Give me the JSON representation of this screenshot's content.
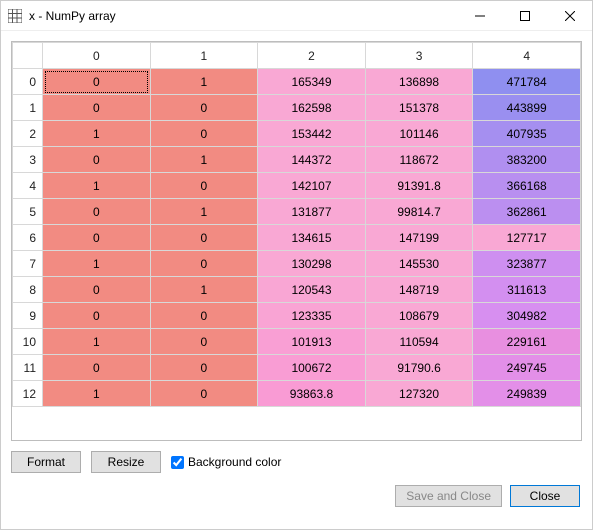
{
  "window": {
    "title": "x - NumPy array"
  },
  "buttons": {
    "format": "Format",
    "resize": "Resize",
    "bgcolor": "Background color",
    "save_close": "Save and Close",
    "close": "Close"
  },
  "checkbox": {
    "bgcolor_checked": true
  },
  "table": {
    "columns": [
      "0",
      "1",
      "2",
      "3",
      "4"
    ],
    "row_headers": [
      "0",
      "1",
      "2",
      "3",
      "4",
      "5",
      "6",
      "7",
      "8",
      "9",
      "10",
      "11",
      "12"
    ],
    "selected_cell": [
      0,
      0
    ]
  },
  "chart_data": {
    "type": "table",
    "title": "x - NumPy array",
    "columns": [
      "0",
      "1",
      "2",
      "3",
      "4"
    ],
    "rows": [
      [
        "0",
        "1",
        "165349",
        "136898",
        "471784"
      ],
      [
        "0",
        "0",
        "162598",
        "151378",
        "443899"
      ],
      [
        "1",
        "0",
        "153442",
        "101146",
        "407935"
      ],
      [
        "0",
        "1",
        "144372",
        "118672",
        "383200"
      ],
      [
        "1",
        "0",
        "142107",
        "91391.8",
        "366168"
      ],
      [
        "0",
        "1",
        "131877",
        "99814.7",
        "362861"
      ],
      [
        "0",
        "0",
        "134615",
        "147199",
        "127717"
      ],
      [
        "1",
        "0",
        "130298",
        "145530",
        "323877"
      ],
      [
        "0",
        "1",
        "120543",
        "148719",
        "311613"
      ],
      [
        "0",
        "0",
        "123335",
        "108679",
        "304982"
      ],
      [
        "1",
        "0",
        "101913",
        "110594",
        "229161"
      ],
      [
        "0",
        "0",
        "100672",
        "91790.6",
        "249745"
      ],
      [
        "1",
        "0",
        "93863.8",
        "127320",
        "249839"
      ]
    ],
    "cell_colors": [
      [
        "#f28b82",
        "#f28b82",
        "#f9a8d4",
        "#f9a8d4",
        "#8f8ff0"
      ],
      [
        "#f28b82",
        "#f28b82",
        "#f9a8d4",
        "#f9a8d4",
        "#9a8ff0"
      ],
      [
        "#f28b82",
        "#f28b82",
        "#f9a8d4",
        "#f9a8d4",
        "#a58ff0"
      ],
      [
        "#f28b82",
        "#f28b82",
        "#f9a8d4",
        "#f9a8d4",
        "#b08ff0"
      ],
      [
        "#f28b82",
        "#f28b82",
        "#f9a8d4",
        "#f9a8d4",
        "#b88ff0"
      ],
      [
        "#f28b82",
        "#f28b82",
        "#f9a8d4",
        "#f9a8d4",
        "#bb8ff0"
      ],
      [
        "#f28b82",
        "#f28b82",
        "#f9a8d4",
        "#f9a8d4",
        "#f9a8d4"
      ],
      [
        "#f28b82",
        "#f28b82",
        "#f9a8d4",
        "#f9a8d4",
        "#ce8ff0"
      ],
      [
        "#f28b82",
        "#f28b82",
        "#f9a6d4",
        "#f9a8d4",
        "#d38ff0"
      ],
      [
        "#f28b82",
        "#f28b82",
        "#f9a4d4",
        "#f9a8d4",
        "#d78ff0"
      ],
      [
        "#f28b82",
        "#f28b82",
        "#f99fd4",
        "#f9a8d4",
        "#e88fe0"
      ],
      [
        "#f28b82",
        "#f28b82",
        "#f99dd4",
        "#f9a8d4",
        "#e38fe8"
      ],
      [
        "#f28b82",
        "#f28b82",
        "#f99bd4",
        "#f9a8d4",
        "#e38fe8"
      ]
    ]
  }
}
